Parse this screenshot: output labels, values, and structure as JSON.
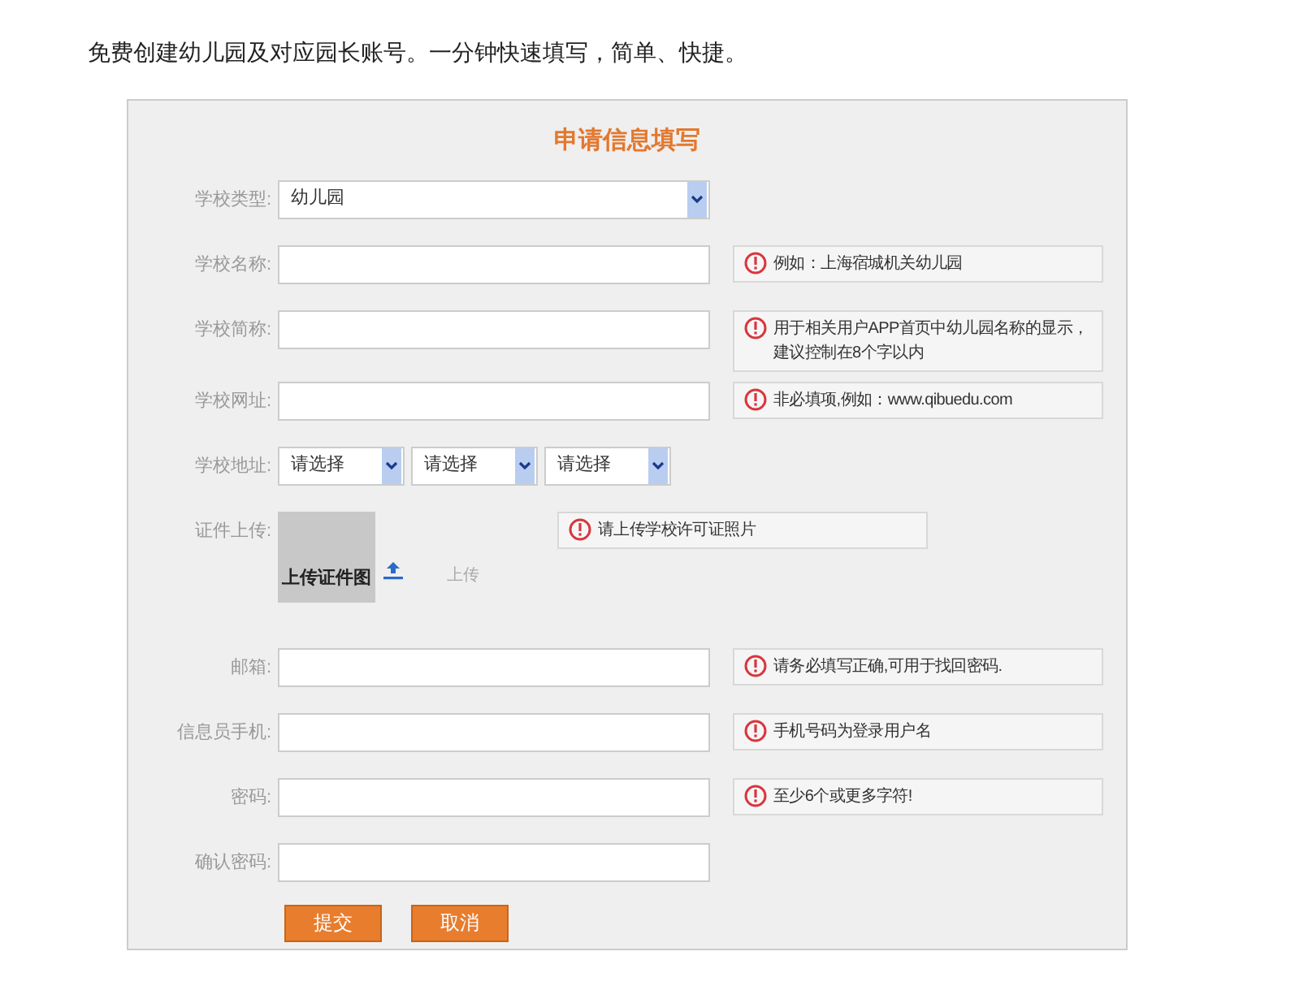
{
  "intro": "免费创建幼儿园及对应园长账号。一分钟快速填写，简单、快捷。",
  "form": {
    "title": "申请信息填写",
    "fields": [
      {
        "kind": "select",
        "label": "学校类型:",
        "value": "幼儿园"
      },
      {
        "kind": "text",
        "label": "学校名称:",
        "hint": "例如：上海宿城机关幼儿园"
      },
      {
        "kind": "text",
        "label": "学校简称:",
        "hint": "用于相关用户APP首页中幼儿园名称的显示，建议控制在8个字以内"
      },
      {
        "kind": "text",
        "label": "学校网址:",
        "hint": "非必填项,例如：www.qibuedu.com"
      },
      {
        "kind": "address",
        "label": "学校地址:",
        "selects": [
          "请选择",
          "请选择",
          "请选择"
        ]
      },
      {
        "kind": "upload",
        "label": "证件上传:",
        "image_text": "上传证件图",
        "upload_label": "上传",
        "hint": "请上传学校许可证照片"
      },
      {
        "kind": "text",
        "label": "邮箱:",
        "hint": "请务必填写正确,可用于找回密码."
      },
      {
        "kind": "text",
        "label": "信息员手机:",
        "hint": "手机号码为登录用户名"
      },
      {
        "kind": "text",
        "label": "密码:",
        "hint": "至少6个或更多字符!"
      },
      {
        "kind": "text",
        "label": "确认密码:"
      }
    ],
    "buttons": [
      "提交",
      "取消"
    ]
  }
}
